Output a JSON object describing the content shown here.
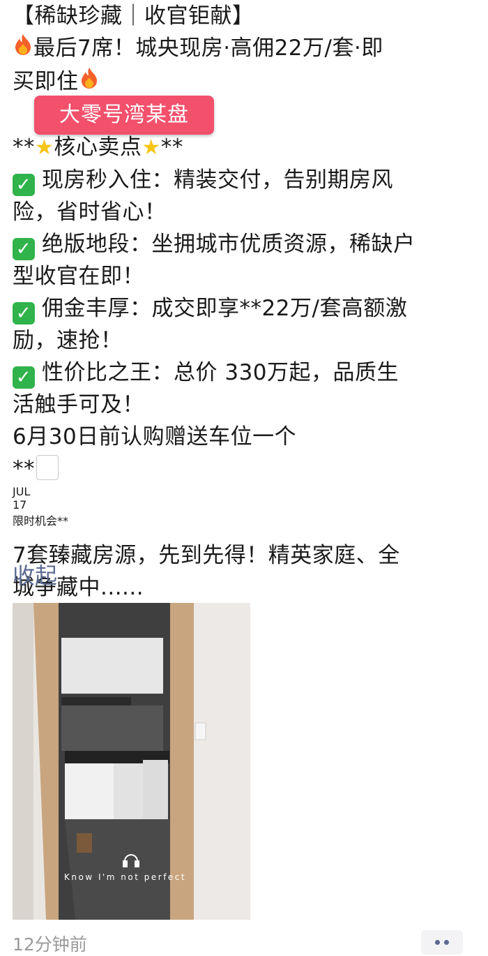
{
  "post": {
    "title": "【稀缺珍藏｜收官钜献】",
    "line_hot_1": "最后7席！城央现房·高佣22万/套·即",
    "line_hot_2": "买即住",
    "overlay_label": "大零号湾某盘",
    "selling_points_header": "核心卖点",
    "bullets": [
      {
        "line1": "现房秒入住：精装交付，告别期房风",
        "line2": "险，省时省心！"
      },
      {
        "line1": "绝版地段：坐拥城市优质资源，稀缺户",
        "line2": "型收官在即！"
      },
      {
        "line1": "佣金丰厚：成交即享**22万/套高额激",
        "line2": "励，速抢！"
      },
      {
        "line1": "性价比之王：总价 330万起，品质生",
        "line2": "活触手可及！"
      }
    ],
    "parking_offer": "6月30日前认购赠送车位一个",
    "calendar_month": "JUL",
    "calendar_day": "17",
    "limited_time": "限时机会**",
    "closing_line1": "7套臻藏房源，先到先得！精英家庭、全",
    "closing_line2": "城争藏中......"
  },
  "actions": {
    "collapse_label": "收起"
  },
  "photo": {
    "caption": "Know I'm not perfect"
  },
  "footer": {
    "timestamp": "12分钟前"
  },
  "icons": {
    "fire": "fire-icon",
    "check": "check-mark-icon",
    "star": "star-icon",
    "calendar": "calendar-icon",
    "headphones": "headphones-icon",
    "more": "more-dots-icon"
  },
  "colors": {
    "link": "#5b6a91",
    "label_bg": "#f2506b",
    "check_bg": "#2fb34a"
  }
}
